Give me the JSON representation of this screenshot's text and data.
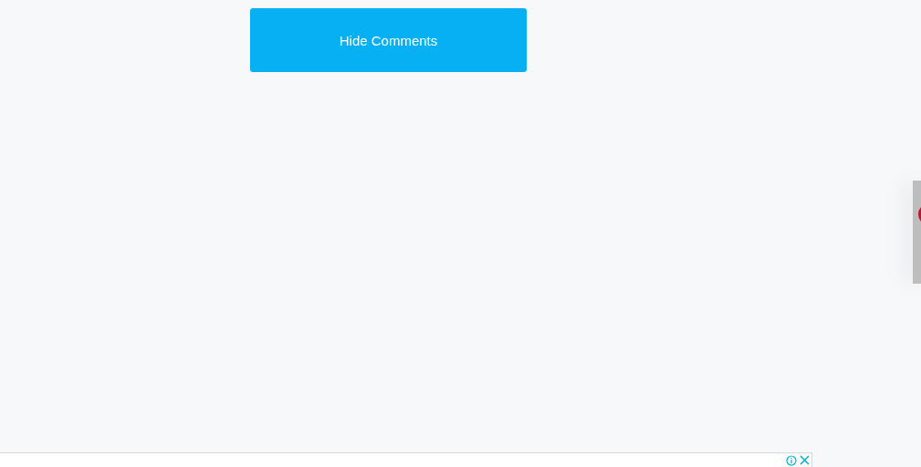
{
  "comments_toggle": {
    "label": "Hide Comments"
  }
}
